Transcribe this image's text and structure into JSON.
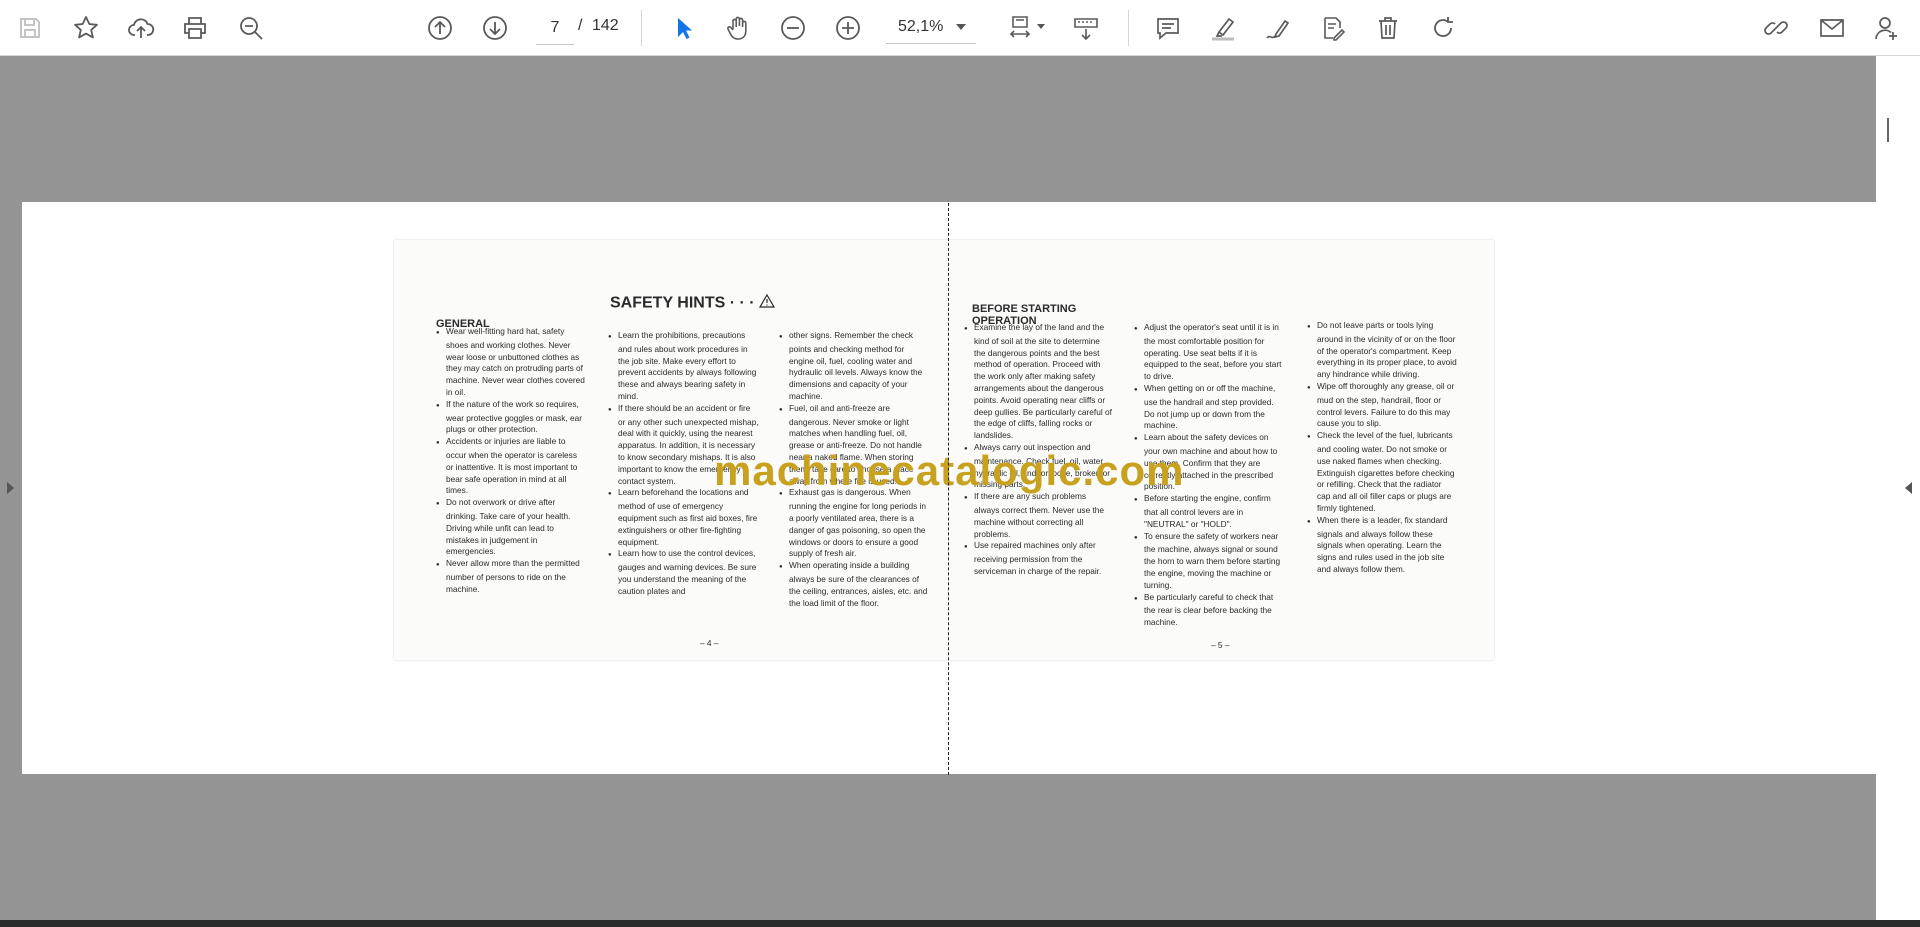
{
  "toolbar": {
    "page_current": "7",
    "page_separator": "/",
    "page_total": "142",
    "zoom": "52,1%"
  },
  "colors": {
    "toolbar_bg": "#ffffff",
    "viewer_bg": "#949494",
    "icon": "#5a5a5a",
    "active_icon": "#1473e6",
    "watermark": "#c8a11f"
  },
  "document": {
    "watermark": "machinecatalogic.com",
    "title": "SAFETY HINTS · · ·",
    "left_heading": "GENERAL",
    "right_heading_line1": "BEFORE STARTING",
    "right_heading_line2": "OPERATION",
    "page_left": "– 4 –",
    "page_right": "– 5 –",
    "general_col1": [
      "Wear well-fitting hard hat, safety shoes and working clothes. Never wear loose or unbuttoned clothes as they may catch on protruding parts of machine. Never wear clothes covered in oil.",
      "If the nature of the work so requires, wear protective goggles or mask, ear plugs or other protection.",
      "Accidents or injuries are liable to occur when the operator is careless or inattentive. It is most important to bear safe operation in mind at all times.",
      "Do not overwork or drive after drinking. Take care of your health. Driving while unfit can lead to mistakes in judgement in emergencies.",
      "Never allow more than the permitted number of persons to ride on the machine."
    ],
    "general_col2": [
      "Learn the prohibitions, precautions and rules about work procedures in the job site. Make every effort to prevent accidents by always following these and always bearing safety in mind.",
      "If there should be an accident or fire or any other such unexpected mishap, deal with it quickly, using the nearest apparatus. In addition, it is necessary to know secondary mishaps. It is also important to know the emergency contact system.",
      "Learn beforehand the locations and method of use of emergency equipment such as first aid boxes, fire extinguishers or other fire-fighting equipment.",
      "Learn how to use the control devices, gauges and warning devices. Be sure you understand the meaning of the caution plates and"
    ],
    "general_col3": [
      "other signs. Remember the check points and checking method for engine oil, fuel, cooling water and hydraulic oil levels. Always know the dimensions and capacity of your machine.",
      "Fuel, oil and anti-freeze are dangerous. Never smoke or light matches when handling fuel, oil, grease or anti-freeze. Do not handle near a naked flame. When storing them, take care to choose a place away from where fire is used.",
      "Exhaust gas is dangerous. When running the engine for long periods in a poorly ventilated area, there is a danger of gas poisoning, so open the windows or doors to ensure a good supply of fresh air.",
      "When operating inside a building always be sure of the clearances of the ceiling, entrances, aisles, etc. and the load limit of the floor."
    ],
    "start_col1": [
      "Examine the lay of the land and the kind of soil at the site to determine the dangerous points and the best method of operation. Proceed with the work only after making safety arrangements about the dangerous points. Avoid operating near cliffs or deep gullies. Be particularly careful of the edge of cliffs, falling rocks or landslides.",
      "Always carry out inspection and maintenance. Check fuel, oil, water, hydraulic oil, and for loose, broken or missing parts.",
      "If there are any such problems always correct them. Never use the machine without correcting all problems.",
      "Use repaired machines only after receiving permission from the serviceman in charge of the repair."
    ],
    "start_col2": [
      "Adjust the operator's seat until it is in the most comfortable position for operating. Use seat belts if it is equipped to the seat, before you start to drive.",
      "When getting on or off the machine, use the handrail and step provided. Do not jump up or down from the machine.",
      "Learn about the safety devices on your own machine and about how to use them. Confirm that they are correctly attached in the prescribed position.",
      "Before starting the engine, confirm that all control levers are in \"NEUTRAL\" or \"HOLD\".",
      "To ensure the safety of workers near the machine, always signal or sound the horn to warn them before starting the engine, moving the machine or turning.",
      "Be particularly careful to check that the rear is clear before backing the machine."
    ],
    "start_col3": [
      "Do not leave parts or tools lying around in the vicinity of or on the floor of the operator's compartment. Keep everything in its proper place, to avoid any hindrance while driving.",
      "Wipe off thoroughly any grease, oil or mud on the step, handrail, floor or control levers. Failure to do this may cause you to slip.",
      "Check the level of the fuel, lubricants and cooling water. Do not smoke or use naked flames when checking. Extinguish cigarettes before checking or refilling. Check that the radiator cap and all oil filler caps or plugs are firmly tightened.",
      "When there is a leader, fix standard signals and always follow these signals when operating. Learn the signs and rules used in the job site and always follow them."
    ]
  }
}
